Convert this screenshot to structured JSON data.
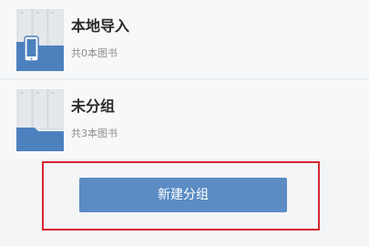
{
  "groups": [
    {
      "title": "本地导入",
      "subtitle": "共0本图书",
      "icon": "folder-phone-icon"
    },
    {
      "title": "未分组",
      "subtitle": "共3本图书",
      "icon": "folder-icon"
    }
  ],
  "actions": {
    "new_group_label": "新建分组"
  },
  "colors": {
    "folder_back": "#e2e6ea",
    "folder_front": "#4d81be",
    "button": "#5b8cc4",
    "highlight": "#d7272f"
  }
}
